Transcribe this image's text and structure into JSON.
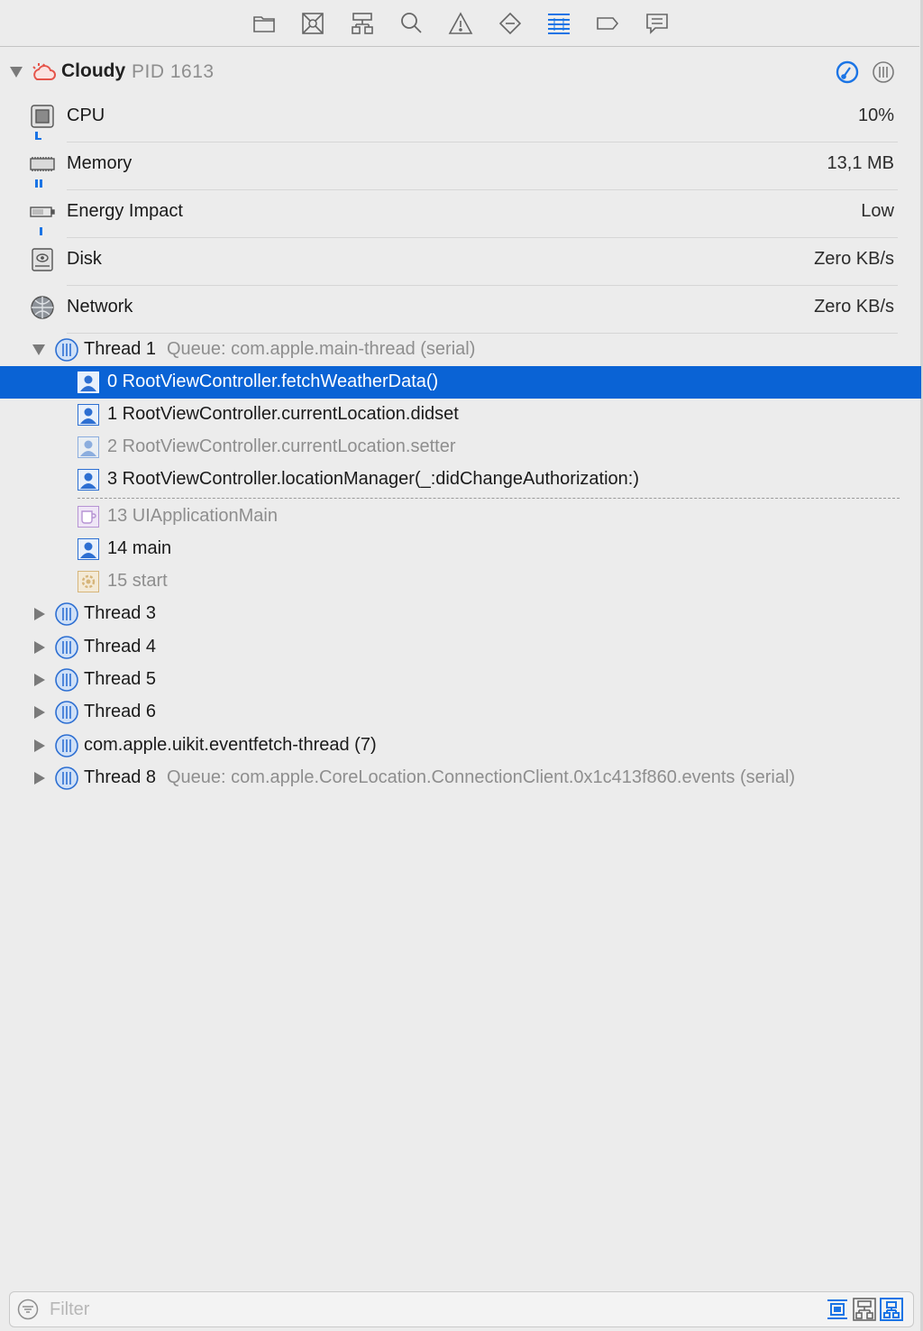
{
  "toolbar": {
    "icons": [
      "folder-icon",
      "source-control-icon",
      "symbol-hierarchy-icon",
      "search-icon",
      "warning-icon",
      "test-diamond-icon",
      "debug-navigator-icon",
      "breakpoint-icon",
      "report-icon"
    ]
  },
  "process": {
    "name": "Cloudy",
    "pid": "PID 1613"
  },
  "gauges": [
    {
      "label": "CPU",
      "value": "10%"
    },
    {
      "label": "Memory",
      "value": "13,1 MB"
    },
    {
      "label": "Energy Impact",
      "value": "Low"
    },
    {
      "label": "Disk",
      "value": "Zero KB/s"
    },
    {
      "label": "Network",
      "value": "Zero KB/s"
    }
  ],
  "thread1": {
    "label": "Thread 1",
    "queue": "Queue: com.apple.main-thread (serial)"
  },
  "frames": [
    {
      "text": "0 RootViewController.fetchWeatherData()"
    },
    {
      "text": "1 RootViewController.currentLocation.didset"
    },
    {
      "text": "2 RootViewController.currentLocation.setter"
    },
    {
      "text": "3 RootViewController.locationManager(_:didChangeAuthorization:)"
    },
    {
      "text": "13 UIApplicationMain"
    },
    {
      "text": "14 main"
    },
    {
      "text": "15 start"
    }
  ],
  "threads": [
    {
      "label": "Thread 3",
      "queue": ""
    },
    {
      "label": "Thread 4",
      "queue": ""
    },
    {
      "label": "Thread 5",
      "queue": ""
    },
    {
      "label": "Thread 6",
      "queue": ""
    },
    {
      "label": "com.apple.uikit.eventfetch-thread (7)",
      "queue": ""
    },
    {
      "label": "Thread 8",
      "queue": "Queue: com.apple.CoreLocation.ConnectionClient.0x1c413f860.events (serial)"
    }
  ],
  "filter": {
    "placeholder": "Filter"
  },
  "colors": {
    "selection": "#0a63d5",
    "accent": "#1a74e5",
    "secondary_text": "#8e8e8e"
  }
}
